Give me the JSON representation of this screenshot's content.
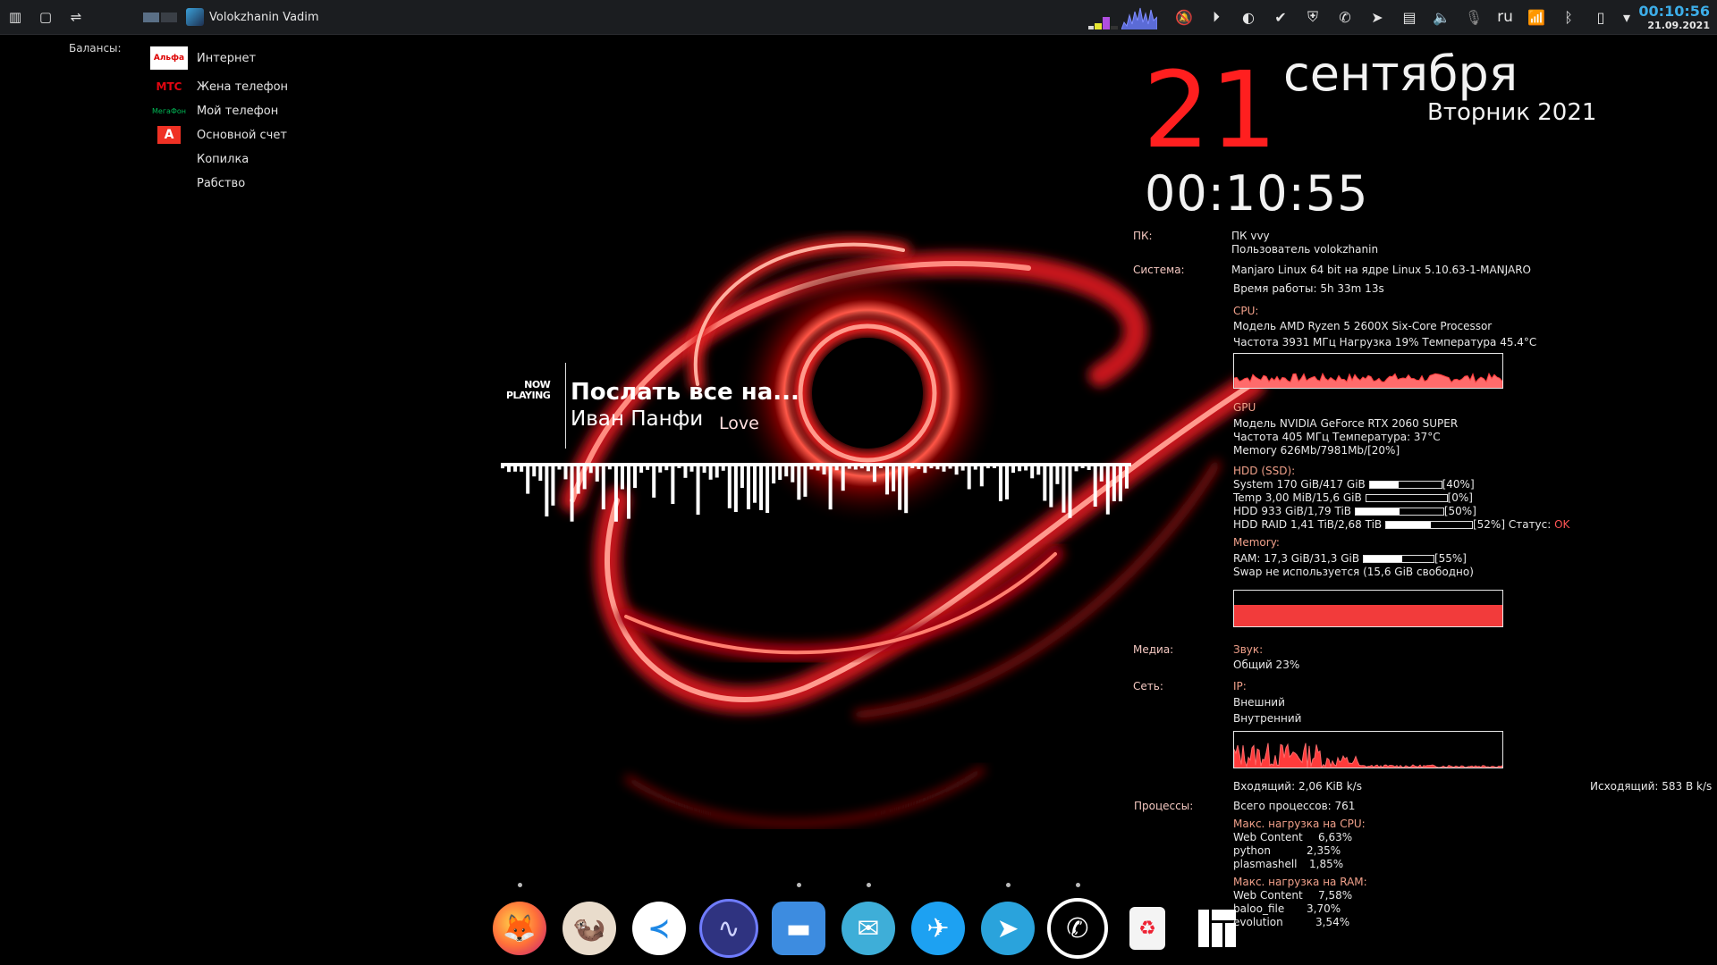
{
  "panel": {
    "task_title": "Volokzhanin Vadim",
    "lang": "ru",
    "clock_time": "00:10:56",
    "clock_date": "21.09.2021"
  },
  "balances": {
    "title": "Балансы:",
    "items": [
      {
        "label": "Интернет",
        "logo": "Альфа"
      },
      {
        "label": "Жена телефон",
        "logo": "МТС"
      },
      {
        "label": "Мой телефон",
        "logo": "МегаФон"
      },
      {
        "label": "Основной счет",
        "logo": "А"
      },
      {
        "label": "Копилка",
        "logo": ""
      },
      {
        "label": "Рабство",
        "logo": ""
      }
    ]
  },
  "datewidget": {
    "day": "21",
    "month": "сентября",
    "weekday_year": "Вторник 2021",
    "time": "00:10:55"
  },
  "sysmon": {
    "pc_label": "ПК:",
    "pc_name": "ПК vvy",
    "user": "Пользователь volokzhanin",
    "system_label": "Система:",
    "system": "Manjaro Linux 64 bit на ядре Linux 5.10.63-1-MANJARO",
    "uptime": "Время работы:  5h 33m 13s",
    "cpu_label": "CPU:",
    "cpu_model": "Модель  AMD Ryzen 5 2600X Six-Core Processor",
    "cpu_stats": "Частота 3931 МГц  Нагрузка 19%   Температура 45.4°C",
    "gpu_label": "GPU",
    "gpu_model": "Модель NVIDIA GeForce RTX 2060 SUPER",
    "gpu_stats": "Частота 405 МГц  Температура: 37°C",
    "gpu_mem": "Memory 626Mb/7981Mb/[20%]",
    "hdd_label": "HDD (SSD):",
    "disks": [
      {
        "text": "System 170 GiB/417 GiB",
        "pct": "[40%]",
        "fill": 0.4
      },
      {
        "text": "Temp 3,00 MiB/15,6 GiB",
        "pct": "[0%]",
        "fill": 0.0
      },
      {
        "text": "HDD 933 GiB/1,79 TiB",
        "pct": "[50%]",
        "fill": 0.5
      },
      {
        "text": "HDD RAID 1,41 TiB/2,68 TiB",
        "pct": "[52%] Статус: ",
        "status": "OK",
        "fill": 0.52
      }
    ],
    "memory_label": "Memory:",
    "ram_text": "RAM: 17,3 GiB/31,3 GiB",
    "ram_pct": "[55%]",
    "ram_fill": 0.55,
    "swap": "Swap не используется (15,6 GiB свободно)",
    "media_label": "Медиа:",
    "sound_label": "Звук:",
    "volume": "Общий 23%",
    "net_label": "Сеть:",
    "ip_label": "IP:",
    "ip_external": "Внешний",
    "ip_internal": "Внутренний",
    "incoming": "Входящий: 2,06 KiB k/s",
    "outgoing": "Исходящий: 583 B k/s",
    "proc_label": "Процессы:",
    "proc_total": "Всего процессов:  761",
    "top_cpu_label": "Макс. нагрузка на CPU:",
    "top_cpu": [
      {
        "name": "Web Content",
        "val": "6,63%"
      },
      {
        "name": "python",
        "val": "2,35%"
      },
      {
        "name": "plasmashell",
        "val": "1,85%"
      }
    ],
    "top_ram_label": "Макс. нагрузка на RAM:",
    "top_ram": [
      {
        "name": "Web Content",
        "val": "7,58%"
      },
      {
        "name": "baloo_file",
        "val": "3,70%"
      },
      {
        "name": "evolution",
        "val": "3,54%"
      }
    ]
  },
  "nowplaying": {
    "badge_line1": "NOW",
    "badge_line2": "PLAYING",
    "title": "Послать все на...",
    "artist": "Иван Панфи",
    "extra": "Love"
  },
  "dock": {
    "apps": [
      {
        "name": "firefox",
        "color": "#ff7139",
        "running": true
      },
      {
        "name": "otter",
        "color": "#e8d9c8",
        "running": false
      },
      {
        "name": "vscode",
        "color": "#ffffff",
        "running": false
      },
      {
        "name": "audio-analyzer",
        "color": "#3b3f8f",
        "running": false
      },
      {
        "name": "files",
        "color": "#3d8ce0",
        "running": true
      },
      {
        "name": "mail",
        "color": "#3eaed8",
        "running": true
      },
      {
        "name": "sky",
        "color": "#1da1f2",
        "running": false
      },
      {
        "name": "telegram",
        "color": "#2aa3dc",
        "running": true
      },
      {
        "name": "whatsapp",
        "color": "#ffffff",
        "running": true
      },
      {
        "name": "trash",
        "color": "#f4f4f4",
        "running": false
      },
      {
        "name": "manjaro",
        "color": "#ffffff",
        "running": false
      }
    ]
  }
}
